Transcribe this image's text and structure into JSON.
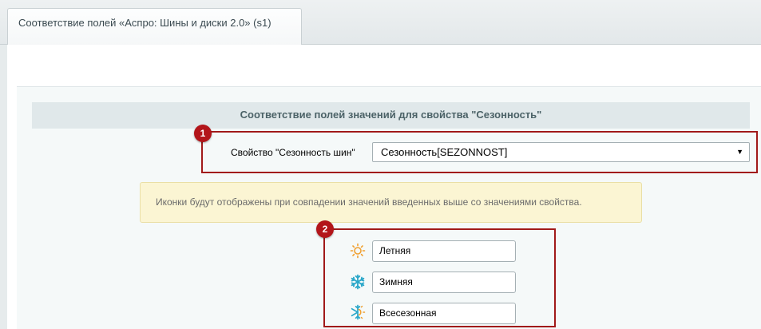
{
  "tab": {
    "label": "Соответствие полей «Аспро: Шины и диски 2.0» (s1)"
  },
  "section": {
    "title": "Соответствие полей значений для свойства \"Сезонность\""
  },
  "badges": [
    "1",
    "2"
  ],
  "property": {
    "label": "Свойство \"Сезонность шин\"",
    "selected": "Сезонность[SEZONNOST]"
  },
  "note": {
    "text": "Иконки будут отображены при совпадении значений введенных выше со значениями свойства."
  },
  "seasons": [
    {
      "icon": "sun-icon",
      "value": "Летняя"
    },
    {
      "icon": "snowflake-icon",
      "value": "Зимняя"
    },
    {
      "icon": "sun-snowflake-icon",
      "value": "Всесезонная"
    }
  ],
  "colors": {
    "highlight": "#a11a1a",
    "badge": "#b3151a",
    "sun": "#f0a030",
    "snow": "#2aa7c9"
  }
}
